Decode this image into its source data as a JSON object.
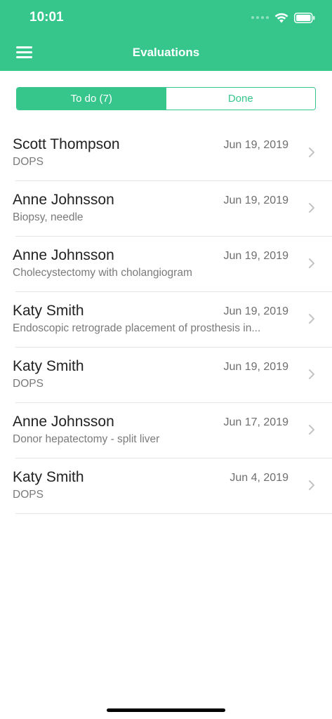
{
  "status_bar": {
    "time": "10:01"
  },
  "header": {
    "title": "Evaluations"
  },
  "segments": {
    "todo": "To do (7)",
    "done": "Done"
  },
  "colors": {
    "accent": "#36c68c"
  },
  "items": [
    {
      "name": "Scott Thompson",
      "procedure": "DOPS",
      "date": "Jun 19, 2019"
    },
    {
      "name": "Anne Johnsson",
      "procedure": "Biopsy, needle",
      "date": "Jun 19, 2019"
    },
    {
      "name": "Anne Johnsson",
      "procedure": "Cholecystectomy with cholangiogram",
      "date": "Jun 19, 2019"
    },
    {
      "name": "Katy Smith",
      "procedure": "Endoscopic retrograde placement of prosthesis in...",
      "date": "Jun 19, 2019"
    },
    {
      "name": "Katy Smith",
      "procedure": "DOPS",
      "date": "Jun 19, 2019"
    },
    {
      "name": "Anne Johnsson",
      "procedure": "Donor hepatectomy - split liver",
      "date": "Jun 17, 2019"
    },
    {
      "name": "Katy Smith",
      "procedure": "DOPS",
      "date": "Jun 4, 2019"
    }
  ]
}
